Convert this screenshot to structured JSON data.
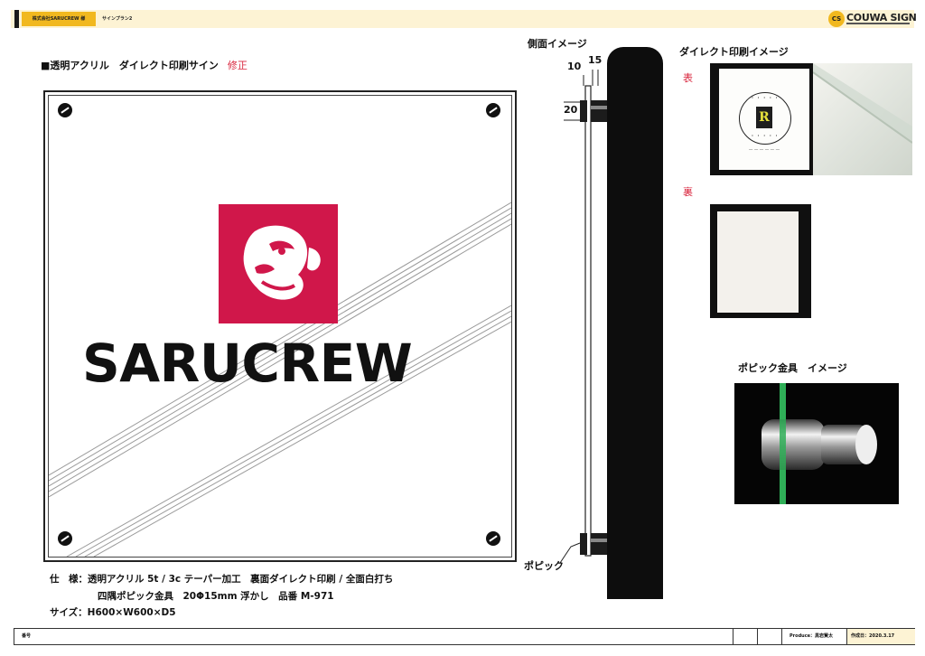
{
  "header": {
    "client": "株式会社SARUCREW 様",
    "plan": "サインプラン2",
    "logo_mark": "CS",
    "logo_text": "COUWA SIGN"
  },
  "sign_section": {
    "title": "■透明アクリル　ダイレクト印刷サイン",
    "fix_note": "修正",
    "brand_text": "SARUCREW",
    "brand_color": "#d0174a"
  },
  "spec": {
    "line1": "仕　様：透明アクリル 5t / 3c テーパー加工　裏面ダイレクト印刷 / 全面白打ち",
    "line2": "四隅ポピック金具　20Φ15mm 浮かし　品番 M-971",
    "line3": "サイズ：H600×W600×D5"
  },
  "side_view": {
    "title": "側面イメージ",
    "dim_10": "10",
    "dim_15": "15",
    "dim_20": "20",
    "pobi_label": "ポピック"
  },
  "direct_print": {
    "title": "ダイレクト印刷イメージ",
    "front_label": "表",
    "back_label": "裏",
    "badge_center": "R"
  },
  "pobi_image": {
    "title": "ポピック金具　イメージ",
    "accent": "#2fae57"
  },
  "footer": {
    "no_label": "番号",
    "produce": "Produce：黒岩賢太",
    "date": "作成日：2020.3.17"
  }
}
